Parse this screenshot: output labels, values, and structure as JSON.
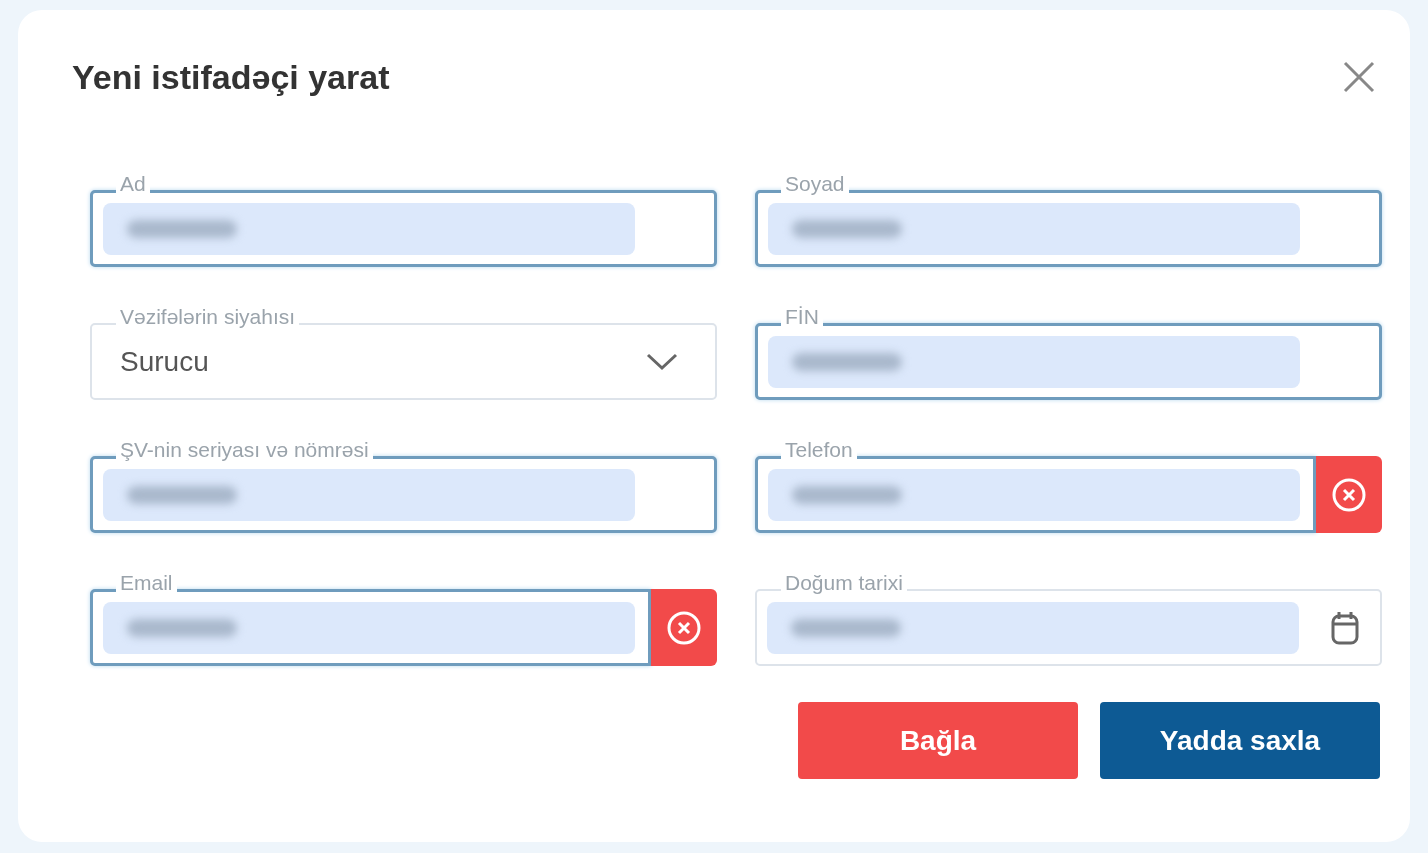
{
  "dialog": {
    "title": "Yeni istifadəçi yarat"
  },
  "fields": [
    {
      "kind": "text",
      "label": "Ad",
      "focused": true,
      "autofilled": true
    },
    {
      "kind": "text",
      "label": "Soyad",
      "focused": true,
      "autofilled": true
    },
    {
      "kind": "select",
      "label": "Vəzifələrin siyahısı",
      "value": "Surucu",
      "focused": false
    },
    {
      "kind": "text",
      "label": "FİN",
      "focused": true,
      "autofilled": true
    },
    {
      "kind": "text",
      "label": "ŞV-nin seriyası və nömrəsi",
      "focused": true,
      "autofilled": true
    },
    {
      "kind": "text",
      "label": "Telefon",
      "focused": true,
      "autofilled": true,
      "clearable": true
    },
    {
      "kind": "text",
      "label": "Email",
      "focused": true,
      "autofilled": true,
      "clearable": true
    },
    {
      "kind": "date",
      "label": "Doğum tarixi",
      "focused": false,
      "autofilled": true
    }
  ],
  "buttons": [
    {
      "kind": "danger",
      "label": "Bağla"
    },
    {
      "kind": "primary",
      "label": "Yadda saxla"
    }
  ]
}
